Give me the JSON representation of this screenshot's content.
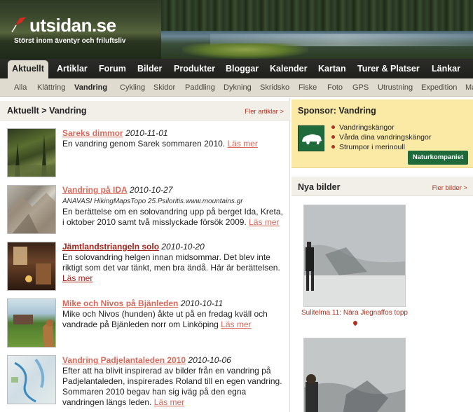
{
  "site": {
    "logo_text": "utsidan.se",
    "tagline": "Störst inom äventyr och friluftsliv"
  },
  "main_nav": [
    "Aktuellt",
    "Artiklar",
    "Forum",
    "Bilder",
    "Produkter",
    "Bloggar",
    "Kalender",
    "Kartan",
    "Turer & Platser",
    "Länkar"
  ],
  "sub_nav": [
    "Alla",
    "Klättring",
    "Vandring",
    "Cykling",
    "Skidor",
    "Paddling",
    "Dykning",
    "Skridsko",
    "Fiske",
    "Foto",
    "GPS",
    "Utrustning",
    "Expedition",
    "Ma"
  ],
  "left": {
    "title": "Aktuellt > Vandring",
    "more": "Fler artiklar >",
    "articles": [
      {
        "title": "Sareks dimmor",
        "date": "2010-11-01",
        "text": "En vandring genom Sarek sommaren 2010.",
        "more": "Läs mer"
      },
      {
        "title": "Vandring på IDA",
        "date": "2010-10-27",
        "sub": "ANAVASI HikingMapsTopo 25.Psiloritis.www.mountains.gr",
        "text": "En berättelse om en solovandring upp på berget Ida, Kreta, i oktober 2010 samt två misslyckade försök 2009.",
        "more": "Läs mer"
      },
      {
        "title": "Jämtlandstriangeln solo",
        "date": "2010-10-20",
        "text": "En solovandring helgen innan midsommar. Det blev inte riktigt som det var tänkt, men bra ändå. Här är berättelsen.",
        "more": "Läs mer"
      },
      {
        "title": "Mike och Nivos på Bjänleden",
        "date": "2010-10-11",
        "text": "Mike och Nivos (hunden) åkte ut på en fredag kväll och vandrade på Bjänleden norr om Linköping",
        "more": "Läs mer"
      },
      {
        "title": "Vandring Padjelantaleden 2010",
        "date": "2010-10-06",
        "text": "Efter att ha blivit inspirerad av bilder från en vandring på Padjelantaleden, inspirerades Roland till en egen vandring. Sommaren 2010 begav han sig iväg på den egna vandringen längs leden.",
        "more": "Läs mer"
      }
    ]
  },
  "sponsor": {
    "title": "Sponsor: Vandring",
    "items": [
      "Vandringskängor",
      "Vårda dina vandringskängor",
      "Strumpor i merinoull"
    ],
    "button": "Naturkompaniet"
  },
  "nya_bilder": {
    "title": "Nya bilder",
    "more": "Fler bilder >",
    "photos": [
      {
        "caption": "Sulitelma 11: Nära Jiegnaffos topp"
      },
      {
        "caption": ""
      }
    ]
  },
  "colors": {
    "nav_bg": "#1f1f1c",
    "subnav_bg": "#dfdbcf",
    "link": "#d8685a",
    "link_dark": "#a8221a",
    "sponsor_bg": "#fbe9a6",
    "sponsor_green": "#1e6a3a"
  }
}
